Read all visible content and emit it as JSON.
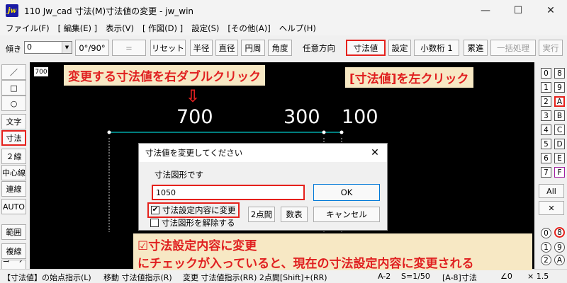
{
  "window": {
    "icon_label": "jw",
    "title": "110 Jw_cad 寸法(M)寸法値の変更 - jw_win",
    "minimize": "—",
    "maximize": "☐",
    "close": "✕"
  },
  "menu": [
    "ファイル(F)",
    "[ 編集(E) ]",
    "表示(V)",
    "[ 作図(D) ]",
    "設定(S)",
    "[その他(A)]",
    "ヘルプ(H)"
  ],
  "toolbar": {
    "tilt_label": "傾き",
    "tilt_value": "0",
    "angle_btn": "0°/90°",
    "equal_btn": "=",
    "reset_btn": "リセット",
    "radius_btn": "半径",
    "diameter_btn": "直径",
    "circumference_btn": "円周",
    "angle2_btn": "角度",
    "any_direction_btn": "任意方向",
    "dim_value_btn": "寸法値",
    "settings_btn": "設定",
    "decimal_btn": "小数桁 1",
    "cumulative_btn": "累進",
    "batch_btn": "一括処理",
    "execute_btn": "実行"
  },
  "left_tools": [
    "／",
    "□",
    "○",
    "文字",
    "寸法",
    "２線",
    "中心線",
    "連線",
    "AUTO",
    "範囲",
    "複線",
    "コーナー"
  ],
  "canvas": {
    "scale_label": "700",
    "annot_top_left": "変更する寸法値を右ダブルクリック",
    "annot_top_right": "[寸法値]を左クリック",
    "arrow": "⇩",
    "dims": [
      "700",
      "300",
      "100"
    ]
  },
  "right_panel": {
    "layer_groups": [
      "0",
      "1",
      "2",
      "3",
      "4",
      "5",
      "6",
      "7"
    ],
    "layers": [
      "8",
      "9",
      "A",
      "B",
      "C",
      "D",
      "E",
      "F"
    ],
    "all_btn": "All",
    "cross_btn": "✕",
    "lower_groups": [
      "0",
      "1",
      "2",
      "3"
    ],
    "lower_layers": [
      "8",
      "9",
      "A",
      "B"
    ]
  },
  "dialog": {
    "title": "寸法値を変更してください",
    "close": "✕",
    "label": "寸法図形です",
    "value": "1050",
    "ok": "OK",
    "check1_label": "寸法設定内容に変更",
    "check1_mark": "✔",
    "check2_label": "寸法図形を解除する",
    "two_point_btn": "2点間",
    "table_btn": "数表",
    "cancel_btn": "キャンセル"
  },
  "annot_bottom": {
    "line1": "☑寸法設定内容に変更",
    "line2": "にチェックが入っていると、現在の寸法設定内容に変更される"
  },
  "status": {
    "hint": "【寸法値】の始点指示(L)",
    "move": "移動 寸法値指示(R)",
    "change": "変更 寸法値指示(RR) 2点間[Shift]+(RR)",
    "sheet": "A-2",
    "scale": "S=1/50",
    "layer": "[A-8]寸法",
    "angle": "∠0",
    "zoom": "× 1.5"
  },
  "colors": {
    "accent_red": "#e5211c",
    "annot_bg": "#f7e8c4",
    "annot_text": "#e02020",
    "canvas_bg": "#000000",
    "dim_line": "#00c8c8"
  }
}
